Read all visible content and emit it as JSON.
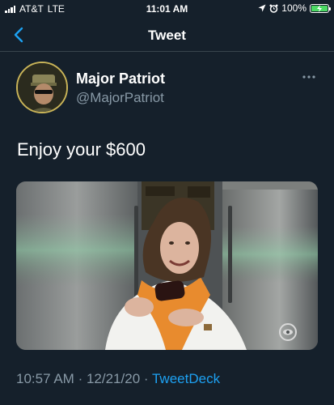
{
  "status_bar": {
    "carrier": "AT&T",
    "network": "LTE",
    "time": "11:01 AM",
    "battery": "100%",
    "battery_level": 1.0
  },
  "nav": {
    "title": "Tweet",
    "back_icon": "chevron-left-icon"
  },
  "tweet": {
    "author_name": "Major Patriot",
    "author_handle": "@MajorPatriot",
    "text": "Enjoy your $600",
    "time": "10:57 AM",
    "separator": "·",
    "date": "12/21/20",
    "source": "TweetDeck"
  },
  "colors": {
    "background": "#15202b",
    "secondary_text": "#8899a6",
    "accent": "#1da1f2"
  }
}
